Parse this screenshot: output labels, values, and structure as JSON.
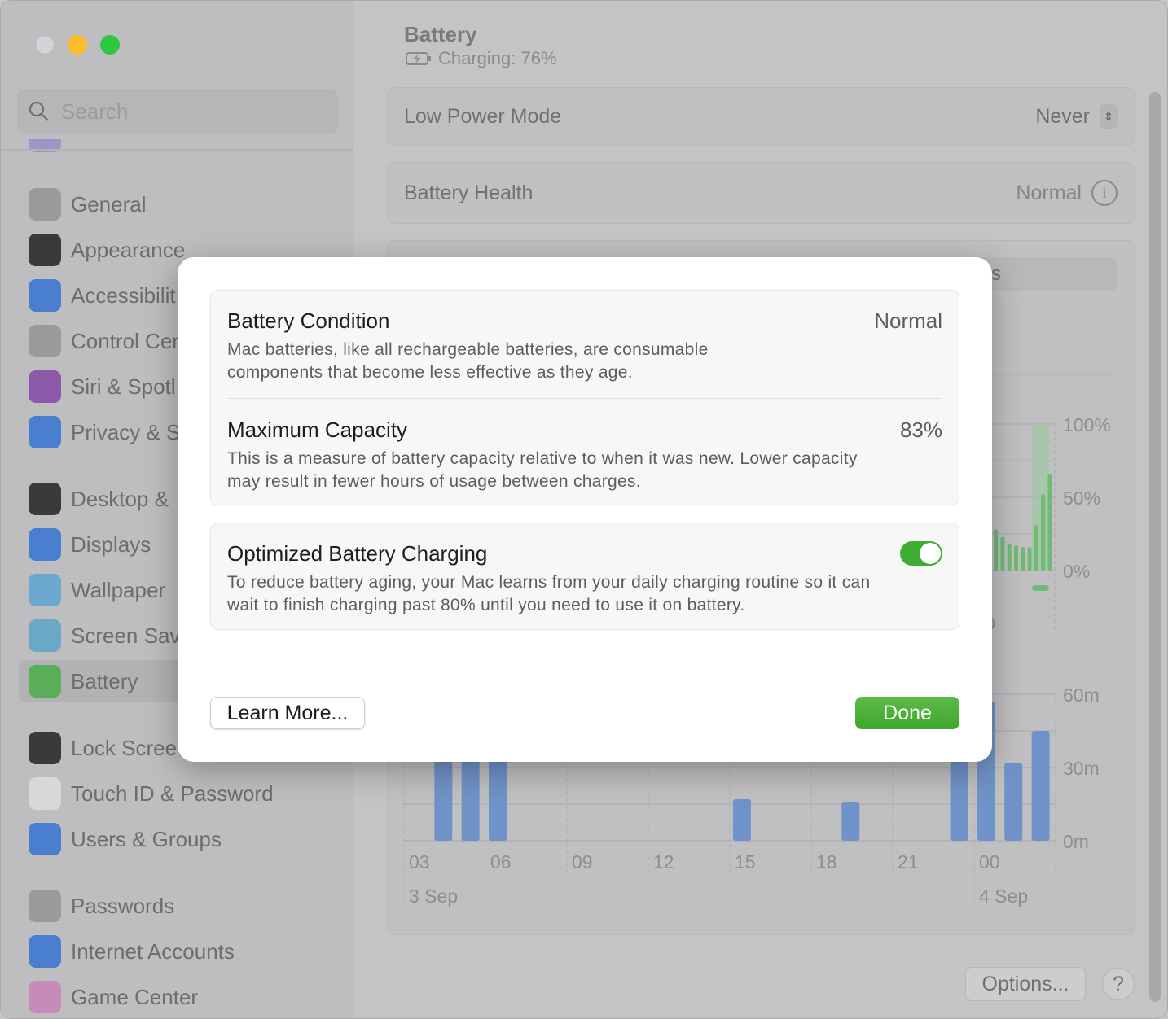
{
  "window": {
    "traffic_lights": [
      "close",
      "minimize",
      "zoom"
    ]
  },
  "sidebar": {
    "search_placeholder": "Search",
    "items": [
      {
        "label": "General",
        "icon": "gear-icon",
        "color": "#9a9a9c"
      },
      {
        "label": "Appearance",
        "icon": "appearance-icon",
        "color": "#3a3a3c"
      },
      {
        "label": "Accessibilit",
        "icon": "accessibility-icon",
        "color": "#4a7fd0"
      },
      {
        "label": "Control Cer",
        "icon": "control-center-icon",
        "color": "#9a9a9c"
      },
      {
        "label": "Siri & Spotl",
        "icon": "siri-icon",
        "color": "#8a5aa8"
      },
      {
        "label": "Privacy & S",
        "icon": "hand-icon",
        "color": "#4a7fd0"
      },
      {
        "label": "Desktop &",
        "icon": "desktop-icon",
        "color": "#3a3a3c"
      },
      {
        "label": "Displays",
        "icon": "sun-icon",
        "color": "#4a7fd0"
      },
      {
        "label": "Wallpaper",
        "icon": "flower-icon",
        "color": "#6aa8d0"
      },
      {
        "label": "Screen Sav",
        "icon": "screensaver-icon",
        "color": "#6aa8c8"
      },
      {
        "label": "Battery",
        "icon": "battery-icon",
        "color": "#5aae5a",
        "selected": true
      },
      {
        "label": "Lock Scree",
        "icon": "lock-icon",
        "color": "#3a3a3c"
      },
      {
        "label": "Touch ID & Password",
        "icon": "fingerprint-icon",
        "color": "#d8d8da"
      },
      {
        "label": "Users & Groups",
        "icon": "users-icon",
        "color": "#4a7fd0"
      },
      {
        "label": "Passwords",
        "icon": "key-icon",
        "color": "#9a9a9c"
      },
      {
        "label": "Internet Accounts",
        "icon": "at-icon",
        "color": "#4a7fd0"
      },
      {
        "label": "Game Center",
        "icon": "game-center-icon",
        "color": "#c88ab8"
      }
    ]
  },
  "main": {
    "title": "Battery",
    "status": "Charging: 76%",
    "low_power_mode": {
      "label": "Low Power Mode",
      "value": "Never"
    },
    "battery_health": {
      "label": "Battery Health",
      "value": "Normal"
    },
    "segment_partial": "s",
    "options_label": "Options...",
    "help_label": "?"
  },
  "chart_data": [
    {
      "type": "bar",
      "title": "",
      "yticks": [
        "100%",
        "50%",
        "0%"
      ],
      "ylim": [
        0,
        100
      ],
      "x_partial_label": "0",
      "values": [
        27,
        28,
        23,
        18,
        17,
        16,
        16,
        31,
        52,
        66
      ],
      "highlight": "last 3 bars",
      "color": "#6fba74"
    },
    {
      "type": "bar",
      "yticks": [
        "60m",
        "30m",
        "0m"
      ],
      "ylim": [
        0,
        60
      ],
      "xticks": [
        "03",
        "06",
        "09",
        "12",
        "15",
        "18",
        "21",
        "00"
      ],
      "date_labels": [
        "3 Sep",
        "4 Sep"
      ],
      "hours": [
        "04",
        "05",
        "06",
        "15",
        "19",
        "23",
        "00",
        "01",
        "02"
      ],
      "values": [
        60,
        60,
        60,
        17,
        16,
        60,
        57,
        32,
        45
      ],
      "color": "#6f93c8"
    }
  ],
  "modal": {
    "condition": {
      "title": "Battery Condition",
      "value": "Normal",
      "desc": "Mac batteries, like all rechargeable batteries, are consumable components that become less effective as they age."
    },
    "capacity": {
      "title": "Maximum Capacity",
      "value": "83%",
      "desc": "This is a measure of battery capacity relative to when it was new. Lower capacity may result in fewer hours of usage between charges."
    },
    "optimized": {
      "title": "Optimized Battery Charging",
      "enabled": true,
      "desc": "To reduce battery aging, your Mac learns from your daily charging routine so it can wait to finish charging past 80% until you need to use it on battery."
    },
    "learn_more": "Learn More...",
    "done": "Done"
  }
}
